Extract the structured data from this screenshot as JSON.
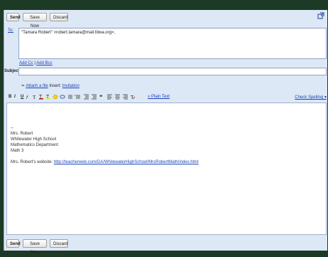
{
  "toolbar": {
    "send_label": "Send",
    "save_now_label": "Save Now",
    "discard_label": "Discard"
  },
  "to": {
    "label": "To:",
    "value": "\"Tamara Robert\" <robert.tamara@mail.fdwa.org>,"
  },
  "links": {
    "add_cc": "Add Cc",
    "sep": " | ",
    "add_bcc": "Add Bcc"
  },
  "subject": {
    "label": "Subject:",
    "value": ""
  },
  "attach": {
    "attach_label": "Attach a file",
    "insert_label": "Insert:",
    "invitation_label": "Invitation"
  },
  "format": {
    "bold": "B",
    "italic": "I",
    "underline": "U",
    "plain_text_label": "« Plain Text",
    "check_spelling_label": "Check Spelling ▾"
  },
  "body": {
    "lines": [
      "--",
      "Mrs. Robert",
      "Whitewater High School",
      "Mathematics Department",
      "Math 3"
    ],
    "website_label": "Mrs. Robert's website:",
    "website_url": "http://teacherweb.com/GA/WhitewaterHighSchool/MrsRobertMath/index.html"
  },
  "colors": {
    "toolbar_bg": "#dde8f6",
    "link": "#1a43b8",
    "outer_bg": "#1d3a26"
  },
  "icons": [
    "popout-icon",
    "attach-paperclip-icon",
    "text-color-icon",
    "highlight-icon",
    "emoticon-icon",
    "link-icon",
    "numbered-list-icon",
    "bulleted-list-icon",
    "quote-icon",
    "indent-icon",
    "outdent-icon",
    "align-left-icon",
    "align-center-icon",
    "align-right-icon",
    "remove-formatting-icon"
  ]
}
